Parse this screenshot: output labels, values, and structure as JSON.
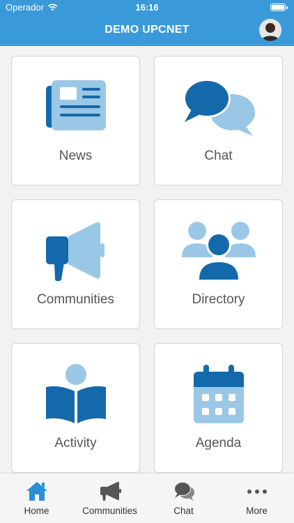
{
  "status_bar": {
    "carrier": "Operador",
    "time": "16:16"
  },
  "header": {
    "title": "DEMO UPCNET"
  },
  "tiles": [
    {
      "label": "News",
      "icon": "newspaper-icon"
    },
    {
      "label": "Chat",
      "icon": "chat-bubbles-icon"
    },
    {
      "label": "Communities",
      "icon": "megaphone-icon"
    },
    {
      "label": "Directory",
      "icon": "people-group-icon"
    },
    {
      "label": "Activity",
      "icon": "reader-book-icon"
    },
    {
      "label": "Agenda",
      "icon": "calendar-icon"
    }
  ],
  "tabbar": {
    "items": [
      {
        "label": "Home",
        "icon": "home-icon",
        "active": true
      },
      {
        "label": "Communities",
        "icon": "megaphone-icon"
      },
      {
        "label": "Chat",
        "icon": "chat-bubbles-icon"
      },
      {
        "label": "More",
        "icon": "more-dots-icon"
      }
    ]
  },
  "colors": {
    "header": "#3a9ad9",
    "icon_dark": "#1469ab",
    "icon_light": "#9ac7e6",
    "active_tab": "#2b8fd6",
    "inactive_tab": "#555555"
  }
}
